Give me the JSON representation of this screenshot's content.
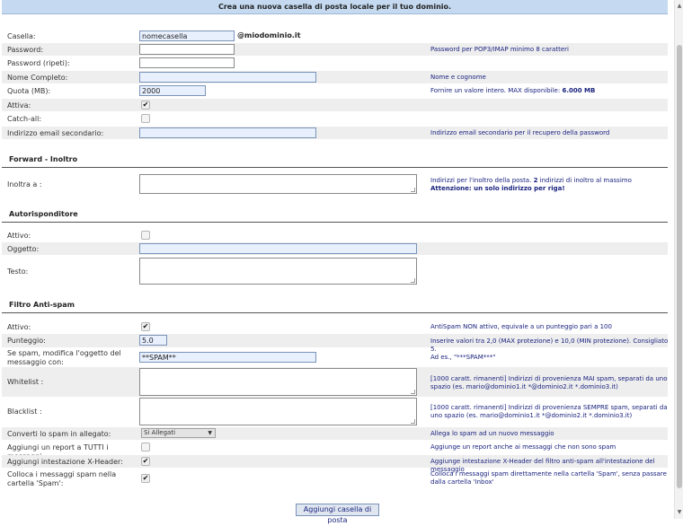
{
  "page": {
    "title": "Crea una nuova casella di posta locale per il tuo dominio.",
    "submit_label": "Aggiungi casella di posta"
  },
  "mailbox": {
    "casella_label": "Casella:",
    "casella_value": "nomecasella",
    "domain": "@miodominio.it",
    "password_label": "Password:",
    "password_hint": "Password per POP3/IMAP minimo 8 caratteri",
    "password_repeat_label": "Password (ripeti):",
    "fullname_label": "Nome Completo:",
    "fullname_hint": "Nome e cognome",
    "quota_label": "Quota (MB):",
    "quota_value": "2000",
    "quota_hint_prefix": "Fornire un valore intero. MAX disponibile: ",
    "quota_hint_max": "6.000 MB",
    "active_label": "Attiva:",
    "catchall_label": "Catch-all:",
    "secondary_email_label": "Indirizzo email secondario:",
    "secondary_email_hint": "Indirizzo email secondario per il recupero della password"
  },
  "forward": {
    "section_title": "Forward - Inoltro",
    "label": "Inoltra a :",
    "hint_line1_prefix": "Indirizzi per l'inoltro della posta. ",
    "hint_line1_num": "2",
    "hint_line1_suffix": " indirizzi di inoltro al massimo",
    "hint_line2": "Attenzione: un solo indirizzo per riga!"
  },
  "autoresponder": {
    "section_title": "Autorisponditore",
    "active_label": "Attivo:",
    "subject_label": "Oggetto:",
    "text_label": "Testo:"
  },
  "antispam": {
    "section_title": "Filtro Anti-spam",
    "active_label": "Attivo:",
    "active_hint": "AntiSpam NON attivo, equivale a un punteggio pari a 100",
    "score_label": "Punteggio:",
    "score_value": "5.0",
    "score_hint": "Inserire valori tra 2,0 (MAX protezione) e 10,0 (MIN protezione). Consigliato 5.",
    "subject_label": "Se spam, modifica l'oggetto del messaggio con:",
    "subject_value": "**SPAM**",
    "subject_hint": "Ad es., \"***SPAM***\"",
    "whitelist_label": "Whitelist :",
    "whitelist_hint": "[1000 caratt. rimanenti] Indirizzi di provenienza MAI spam, separati da uno spazio (es. mario@dominio1.it *@dominio2.it *.dominio3.it)",
    "blacklist_label": "Blacklist :",
    "blacklist_hint": "[1000 caratt. rimanenti] Indirizzi di provenienza SEMPRE spam, separati da uno spazio (es. mario@dominio1.it *@dominio2.it *.dominio3.it)",
    "attachment_label": "Converti lo spam in allegato:",
    "attachment_value": "Si Allegati",
    "attachment_hint": "Allega lo spam ad un nuovo messaggio",
    "report_label": "Aggiungi un report a TUTTI i messaggi:",
    "report_hint": "Aggiunge un report anche ai messaggi che non sono spam",
    "xheader_label": "Aggiungi intestazione X-Header:",
    "xheader_hint": "Aggiunge intestazione X-Header del filtro anti-spam all'intestazione del messaggio",
    "folder_label": "Colloca i messaggi spam nella cartella 'Spam':",
    "folder_hint": "Colloca i messaggi spam direttamente nella cartella 'Spam', senza passare dalla cartella 'Inbox'"
  },
  "checkboxes": {
    "mailbox_active": true,
    "catchall": false,
    "autoresponder_active": false,
    "antispam_active": true,
    "report_all": false,
    "xheader": true,
    "spam_folder": true,
    "check_glyph": "✔"
  },
  "colors": {
    "banner": "#c5daf0",
    "hint_text": "#1a237e",
    "alt_row": "#eeeeee",
    "focused_input": "#e8f0fe"
  }
}
